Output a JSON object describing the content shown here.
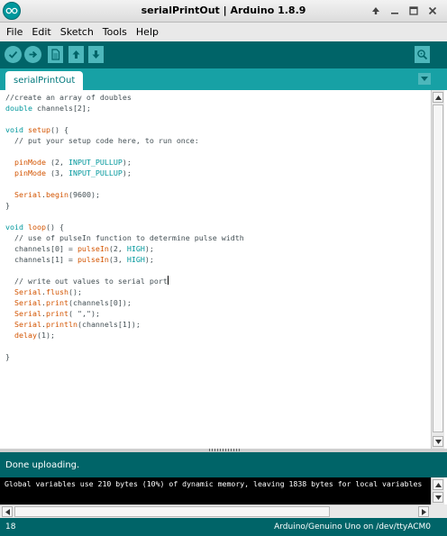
{
  "window": {
    "title": "serialPrintOut | Arduino 1.8.9",
    "controls": [
      "up-arrow-icon",
      "minimize-icon",
      "maximize-icon",
      "close-icon"
    ]
  },
  "menu": {
    "items": [
      {
        "label": "File"
      },
      {
        "label": "Edit"
      },
      {
        "label": "Sketch"
      },
      {
        "label": "Tools"
      },
      {
        "label": "Help"
      }
    ]
  },
  "toolbar": {
    "buttons": [
      "verify-icon",
      "upload-icon",
      "new-icon",
      "open-icon",
      "save-icon"
    ],
    "right_button": "serial-monitor-icon"
  },
  "tabs": {
    "active": "serialPrintOut"
  },
  "editor": {
    "lines": [
      [
        {
          "t": "//create an array of doubles",
          "c": "comment"
        }
      ],
      [
        {
          "t": "double",
          "c": "kw-type"
        },
        {
          "t": " channels[2];",
          "c": ""
        }
      ],
      [
        {
          "t": "",
          "c": ""
        }
      ],
      [
        {
          "t": "void",
          "c": "kw-type"
        },
        {
          "t": " ",
          "c": ""
        },
        {
          "t": "setup",
          "c": "kw-func"
        },
        {
          "t": "() {",
          "c": ""
        }
      ],
      [
        {
          "t": "  // put your setup code here, to run once:",
          "c": "comment"
        }
      ],
      [
        {
          "t": "",
          "c": ""
        }
      ],
      [
        {
          "t": "  ",
          "c": ""
        },
        {
          "t": "pinMode",
          "c": "kw-func"
        },
        {
          "t": " (2, ",
          "c": ""
        },
        {
          "t": "INPUT_PULLUP",
          "c": "kw-const"
        },
        {
          "t": ");",
          "c": ""
        }
      ],
      [
        {
          "t": "  ",
          "c": ""
        },
        {
          "t": "pinMode",
          "c": "kw-func"
        },
        {
          "t": " (3, ",
          "c": ""
        },
        {
          "t": "INPUT_PULLUP",
          "c": "kw-const"
        },
        {
          "t": ");",
          "c": ""
        }
      ],
      [
        {
          "t": "",
          "c": ""
        }
      ],
      [
        {
          "t": "  ",
          "c": ""
        },
        {
          "t": "Serial",
          "c": "kw-func"
        },
        {
          "t": ".",
          "c": ""
        },
        {
          "t": "begin",
          "c": "kw-func"
        },
        {
          "t": "(9600);",
          "c": ""
        }
      ],
      [
        {
          "t": "}",
          "c": ""
        }
      ],
      [
        {
          "t": "",
          "c": ""
        }
      ],
      [
        {
          "t": "void",
          "c": "kw-type"
        },
        {
          "t": " ",
          "c": ""
        },
        {
          "t": "loop",
          "c": "kw-func"
        },
        {
          "t": "() {",
          "c": ""
        }
      ],
      [
        {
          "t": "  // use of pulseIn function to determine pulse width",
          "c": "comment"
        }
      ],
      [
        {
          "t": "  channels[0] = ",
          "c": ""
        },
        {
          "t": "pulseIn",
          "c": "kw-func"
        },
        {
          "t": "(2, ",
          "c": ""
        },
        {
          "t": "HIGH",
          "c": "kw-const"
        },
        {
          "t": ");",
          "c": ""
        }
      ],
      [
        {
          "t": "  channels[1] = ",
          "c": ""
        },
        {
          "t": "pulseIn",
          "c": "kw-func"
        },
        {
          "t": "(3, ",
          "c": ""
        },
        {
          "t": "HIGH",
          "c": "kw-const"
        },
        {
          "t": ");",
          "c": ""
        }
      ],
      [
        {
          "t": "",
          "c": ""
        }
      ],
      [
        {
          "t": "  // write out values to serial port",
          "c": "comment"
        },
        {
          "t": "",
          "c": "caret"
        }
      ],
      [
        {
          "t": "  ",
          "c": ""
        },
        {
          "t": "Serial",
          "c": "kw-func"
        },
        {
          "t": ".",
          "c": ""
        },
        {
          "t": "flush",
          "c": "kw-func"
        },
        {
          "t": "();",
          "c": ""
        }
      ],
      [
        {
          "t": "  ",
          "c": ""
        },
        {
          "t": "Serial",
          "c": "kw-func"
        },
        {
          "t": ".",
          "c": ""
        },
        {
          "t": "print",
          "c": "kw-func"
        },
        {
          "t": "(channels[0]);",
          "c": ""
        }
      ],
      [
        {
          "t": "  ",
          "c": ""
        },
        {
          "t": "Serial",
          "c": "kw-func"
        },
        {
          "t": ".",
          "c": ""
        },
        {
          "t": "print",
          "c": "kw-func"
        },
        {
          "t": "( \",\");",
          "c": ""
        }
      ],
      [
        {
          "t": "  ",
          "c": ""
        },
        {
          "t": "Serial",
          "c": "kw-func"
        },
        {
          "t": ".",
          "c": ""
        },
        {
          "t": "println",
          "c": "kw-func"
        },
        {
          "t": "(channels[1]);",
          "c": ""
        }
      ],
      [
        {
          "t": "  ",
          "c": ""
        },
        {
          "t": "delay",
          "c": "kw-func"
        },
        {
          "t": "(1);",
          "c": ""
        }
      ],
      [
        {
          "t": "",
          "c": ""
        }
      ],
      [
        {
          "t": "}",
          "c": ""
        }
      ]
    ]
  },
  "status": {
    "message": "Done uploading."
  },
  "console": {
    "text": "Global variables use 210 bytes (10%) of dynamic memory, leaving 1838 bytes for local variables"
  },
  "footer": {
    "line_number": "18",
    "board": "Arduino/Genuino Uno on /dev/ttyACM0"
  },
  "colors": {
    "toolbar": "#006468",
    "tabbar": "#17a1a5",
    "button": "#4db7bb",
    "keyword_type": "#00979c",
    "keyword_func": "#d35400"
  }
}
